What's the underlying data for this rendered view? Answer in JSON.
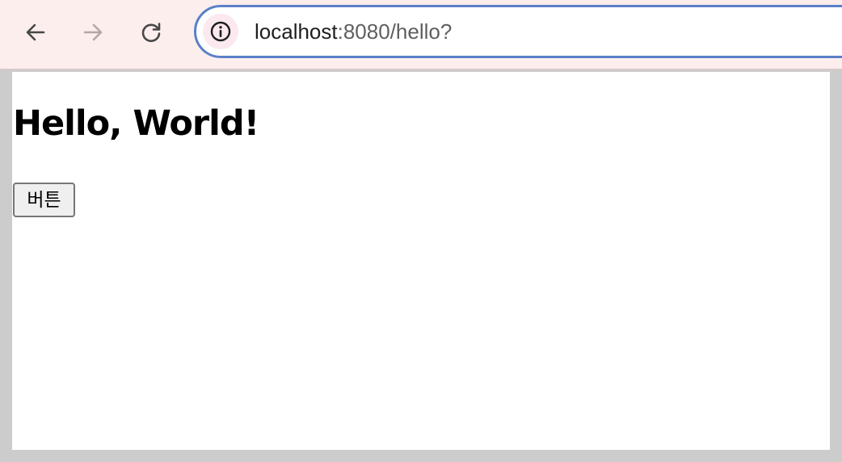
{
  "browser": {
    "url": {
      "host": "localhost",
      "rest": ":8080/hello?"
    },
    "icons": {
      "back": "arrow-left",
      "forward": "arrow-right",
      "reload": "reload",
      "site_info": "info-circle"
    },
    "colors": {
      "toolbar_bg": "#fdeeee",
      "omnibox_border": "#5a80c7",
      "window_frame": "#cccccc"
    }
  },
  "page": {
    "heading": "Hello, World!",
    "button_label": "버튼"
  }
}
